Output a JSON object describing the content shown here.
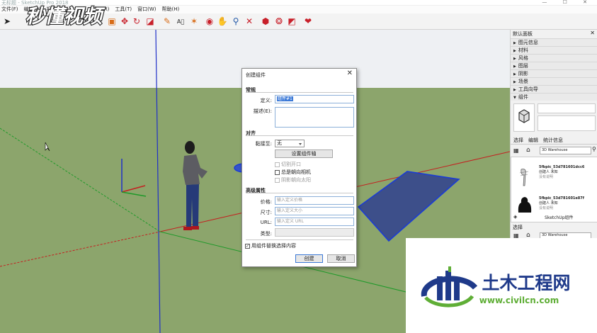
{
  "window": {
    "title": "无标题 - SketchUp Pro 2018",
    "controls": "—  ☐  ✕"
  },
  "menubar": [
    "文件(F)",
    "编辑(E)",
    "视图(V)",
    "相机(C)",
    "绘图(R)",
    "工具(T)",
    "窗口(W)",
    "帮助(H)"
  ],
  "watermark_text": "秒懂视频",
  "toolbar_icons": [
    "select-icon",
    "eraser-icon",
    "paint-icon",
    "push-pull-icon",
    "move-icon",
    "rotate-icon",
    "scale-icon",
    "tape-measure-icon",
    "text-icon",
    "axes-icon",
    "dimension-icon",
    "orbit-icon",
    "pan-icon",
    "zoom-icon",
    "zoom-extents-icon",
    "warehouse-icon",
    "extension-warehouse-icon",
    "layout-icon",
    "component-icon"
  ],
  "dialog": {
    "title": "创建组件",
    "close": "✕",
    "section_general": "常规",
    "label_definition": "定义:",
    "definition_value": "组件#1",
    "label_description": "描述(E):",
    "section_align": "对齐",
    "label_glue": "黏接至:",
    "glue_value": "无",
    "set_axes_button": "设置组件轴",
    "cut_opening": "切割开口",
    "always_face_camera": "总是朝向相机",
    "shadows_face_sun": "阴影朝向太阳",
    "section_advanced": "高级属性",
    "label_price": "价格:",
    "price_placeholder": "输入定义价格",
    "label_size": "尺寸:",
    "size_placeholder": "输入定义大小",
    "label_url": "URL:",
    "url_placeholder": "输入定义 URL",
    "label_type": "类型:",
    "replace_selection": "用组件替换选择内容",
    "create_button": "创建",
    "cancel_button": "取消"
  },
  "tray": {
    "title": "默认面板",
    "close": "✕",
    "panels": [
      "图元信息",
      "材料",
      "风格",
      "图层",
      "阴影",
      "场景",
      "工具向导",
      "组件"
    ],
    "tabs": [
      "选择",
      "编辑",
      "统计信息"
    ],
    "search_value": "3D Warehouse",
    "items": [
      {
        "name": "5fbpic_53d781601dcc6",
        "line2": "创建人 未知",
        "line3": "没有说明"
      },
      {
        "name": "5fbpic_53d781601e87f",
        "line2": "创建人 未知",
        "line3": "没有说明"
      }
    ],
    "footer": "SketchUp组件",
    "select_label": "选择",
    "search_value_2": "3D Warehouse"
  },
  "logo": {
    "title": "土木工程网",
    "url": "www.civilcn.com"
  },
  "colors": {
    "sky": "#eef0f3",
    "ground": "#8ca56c",
    "selection_blue": "#1a3cd6",
    "axis_red": "#c42020",
    "axis_green": "#1f9a2a",
    "axis_blue": "#2030c8",
    "logo_blue": "#1f3a8a",
    "logo_green": "#5fae36"
  }
}
